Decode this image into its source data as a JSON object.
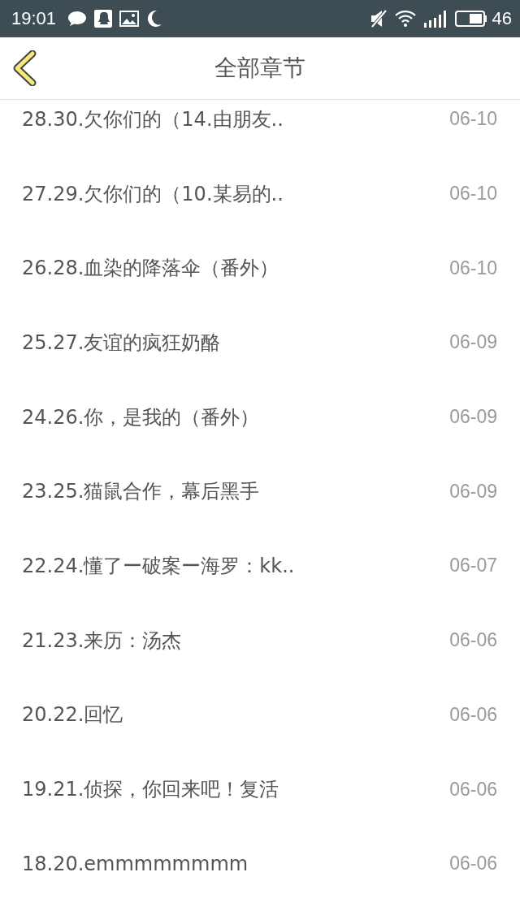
{
  "status_bar": {
    "time": "19:01",
    "battery": "46"
  },
  "header": {
    "title": "全部章节"
  },
  "chapters": [
    {
      "title": "28.30.欠你们的（14.由朋友..",
      "date": "06-10"
    },
    {
      "title": "27.29.欠你们的（10.某易的..",
      "date": "06-10"
    },
    {
      "title": "26.28.血染的降落伞（番外）",
      "date": "06-10"
    },
    {
      "title": "25.27.友谊的疯狂奶酪",
      "date": "06-09"
    },
    {
      "title": "24.26.你，是我的（番外）",
      "date": "06-09"
    },
    {
      "title": "23.25.猫鼠合作，幕后黑手",
      "date": "06-09"
    },
    {
      "title": "22.24.懂了ー破案ー海罗：kk..",
      "date": "06-07"
    },
    {
      "title": "21.23.来历：汤杰",
      "date": "06-06"
    },
    {
      "title": "20.22.回忆",
      "date": "06-06"
    },
    {
      "title": "19.21.侦探，你回来吧！复活",
      "date": "06-06"
    },
    {
      "title": "18.20.emmmmmmmm",
      "date": "06-06"
    }
  ]
}
